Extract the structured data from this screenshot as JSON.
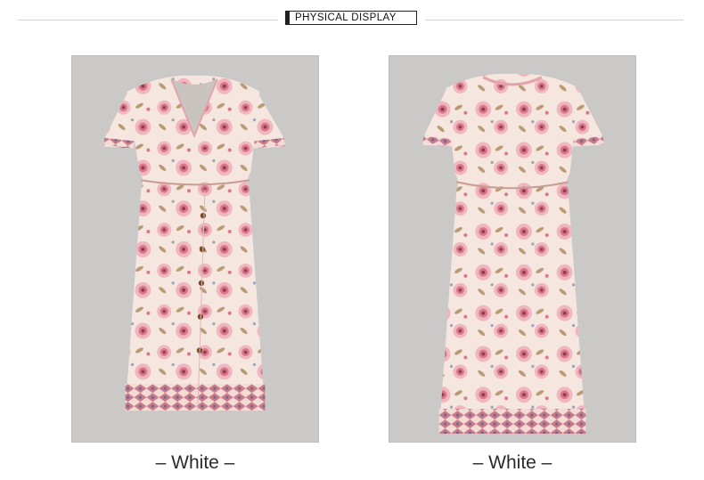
{
  "header": {
    "title": "PHYSICAL DISPLAY"
  },
  "photos": [
    {
      "view": "front",
      "caption": "– White –"
    },
    {
      "view": "back",
      "caption": "– White –"
    }
  ],
  "colors": {
    "background": "#ffffff",
    "photo_backdrop": "#cbc9c8",
    "dress_base": "#f5e6df",
    "flower_pink": "#d9768a",
    "flower_light": "#efb6c0",
    "leaf": "#b89a73",
    "button": "#7a4b2a"
  }
}
